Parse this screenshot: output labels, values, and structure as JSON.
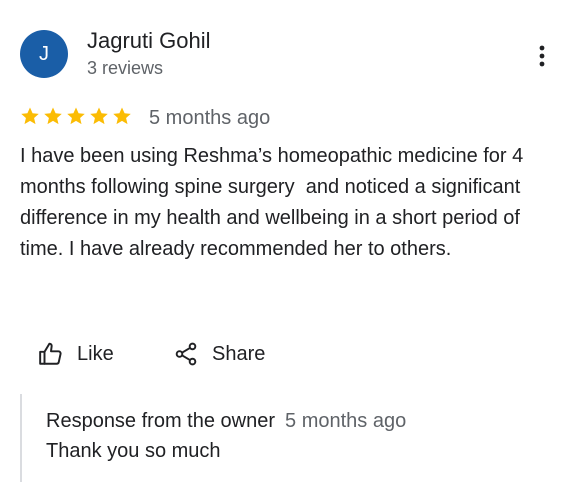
{
  "review": {
    "author": {
      "initial": "J",
      "name": "Jagruti Gohil",
      "reviews_count": "3 reviews",
      "avatar_color": "#1a5ea7"
    },
    "more_icon": "more-vert-icon",
    "rating": {
      "stars": 5,
      "max": 5,
      "star_color": "#fbbc04",
      "time": "5 months ago"
    },
    "text": "I have been using Reshma’s homeopathic medicine for 4 months following spine surgery  and noticed a significant difference in my health and wellbeing in a short period of time. I have already recommended her to others.",
    "actions": {
      "like": {
        "icon": "thumbs-up-icon",
        "label": "Like"
      },
      "share": {
        "icon": "share-icon",
        "label": "Share"
      }
    },
    "owner_response": {
      "label": "Response from the owner",
      "time": "5 months ago",
      "text": "Thank you so much"
    }
  }
}
